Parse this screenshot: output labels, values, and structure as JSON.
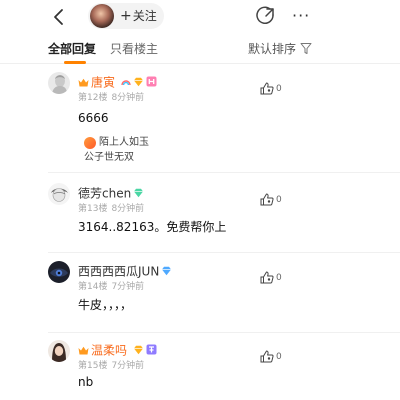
{
  "nav": {
    "follow_label": "关注",
    "more_glyph": "···"
  },
  "filters": {
    "tabs": [
      {
        "label": "全部回复",
        "active": true
      },
      {
        "label": "只看楼主",
        "active": false
      }
    ],
    "sort_label": "默认排序"
  },
  "colors": {
    "accent": "#ff8200",
    "member_name": "#f86b1d",
    "meta_gray": "#a9a9a9"
  },
  "comments": [
    {
      "name": "唐寅",
      "member": true,
      "floor": "第12楼",
      "time": "8分钟前",
      "likes": "0",
      "text": "6666",
      "card": {
        "line1": "陌上人如玉",
        "line2": "公子世无双"
      }
    },
    {
      "name": "德芳chen",
      "member": false,
      "floor": "第13楼",
      "time": "8分钟前",
      "likes": "0",
      "text": "3164..82163。免费帮你上"
    },
    {
      "name": "西西西西瓜JUN",
      "member": false,
      "floor": "第14楼",
      "time": "7分钟前",
      "likes": "0",
      "text": "牛皮，，，，"
    },
    {
      "name": "温柔吗",
      "member": true,
      "floor": "第15楼",
      "time": "7分钟前",
      "likes": "0",
      "text": "nb"
    }
  ]
}
